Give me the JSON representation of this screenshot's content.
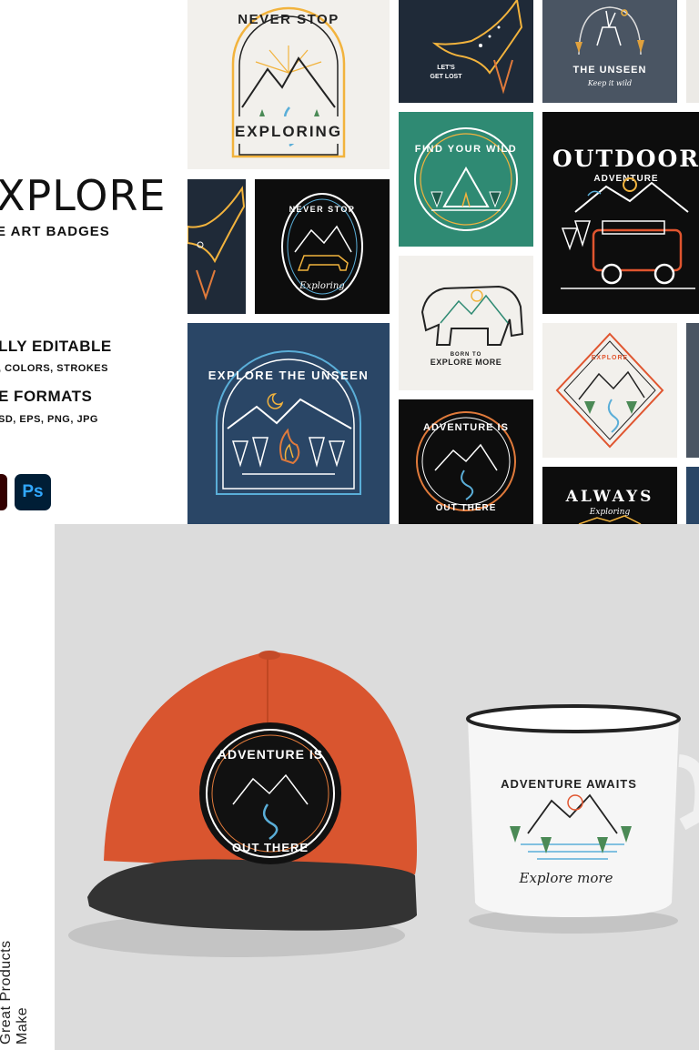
{
  "header": {
    "title": "XPLORE",
    "subtitle": "E ART BADGES",
    "features": [
      {
        "title": "LLY EDITABLE",
        "desc": ", COLORS, STROKES"
      },
      {
        "title": "E FORMATS",
        "desc": "SD, EPS, PNG, JPG"
      }
    ],
    "app_icons": [
      {
        "name": "illustrator-icon",
        "label": ""
      },
      {
        "name": "photoshop-icon",
        "label": "Ps"
      }
    ]
  },
  "badges": {
    "never_stop": {
      "top": "NEVER STOP",
      "bottom": "EXPLORING"
    },
    "eagle_lost": {
      "line1": "LET'S",
      "line2": "GET LOST"
    },
    "unseen_deer": {
      "title": "THE UNSEEN",
      "script": "Keep it wild"
    },
    "find_wild": {
      "text": "FIND YOUR WILD"
    },
    "outdoor": {
      "title": "OUTDOOR",
      "sub": "ADVENTURE"
    },
    "bear_never_stop": {
      "top": "NEVER STOP",
      "script": "Exploring"
    },
    "bear_born": {
      "line1": "BORN TO",
      "line2": "EXPLORE MORE"
    },
    "explore_diamond": {
      "text": "EXPLORE"
    },
    "explore_unseen": {
      "text": "EXPLORE THE UNSEEN"
    },
    "adventure_out": {
      "top": "ADVENTURE IS",
      "bottom": "OUT THERE"
    },
    "always": {
      "title": "ALWAYS",
      "script": "Exploring"
    }
  },
  "mockup": {
    "cap_badge": {
      "top": "ADVENTURE IS",
      "bottom": "OUT THERE"
    },
    "mug": {
      "arc": "ADVENTURE AWAITS",
      "script": "Explore more"
    },
    "side_text": {
      "line1": "Make",
      "line2": "Great Products"
    }
  },
  "colors": {
    "navy": "#1f2a38",
    "slate": "#4a5563",
    "teal": "#2f8a73",
    "black": "#0d0d0d",
    "blue": "#2a4666",
    "cream": "#f2f0ec",
    "orange": "#e07a3b",
    "cap": "#d9552f",
    "mockup_bg": "#dcdcdc"
  }
}
